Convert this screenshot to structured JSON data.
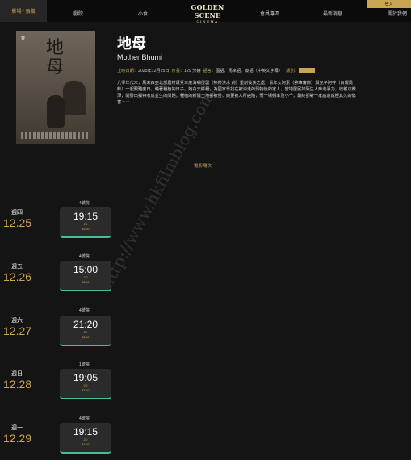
{
  "nav": {
    "left": "影場 / 預購",
    "items": [
      "戲院",
      "小食",
      "會員專區",
      "最新消息",
      "關於我們"
    ],
    "logo_line1": "GOLDEN SCENE",
    "logo_line2": "CINEMA",
    "login": "登入"
  },
  "movie": {
    "title_zh": "地母",
    "title_en": "Mother Bhumi",
    "poster_badge": "豐",
    "poster_title": "地母",
    "meta": {
      "release_label": "上映日期：",
      "release": "2025年12月25日",
      "runtime_label": "片長：",
      "runtime": "129 分鐘",
      "language_label": "語言：",
      "language": "國語、馬來語、泰語（中英文字幕）",
      "rating_label": "級別："
    },
    "synopsis": "九零年代末，馬來西亞北部農村遭受三度海嘯侵襲（熱帶洪水 劇）重創後失之處，青年女阿素（許瑋甯飾）與兒子阿梓（白耀喬 飾）一起艱難度日，藉著種植的日子。她白天耕種，為國家尋找在被沖走的穀物後的家人，當地居民如陌生人奔走爭力，收穫以微薄，開發出獨特收成並生的問題，種植的新疆土地卻被侵，她更被人所誣陷，而一場頻率及小千，最終卻對一家庭造成極其久的傷害⋯⋯"
  },
  "schedule_label": "電影場次",
  "schedule": [
    {
      "weekday": "週四",
      "date": "12.25",
      "hall": "4號院",
      "time": "19:15",
      "format": "2D",
      "price": "$100"
    },
    {
      "weekday": "週五",
      "date": "12.26",
      "hall": "4號院",
      "time": "15:00",
      "format": "2D",
      "price": "$100"
    },
    {
      "weekday": "週六",
      "date": "12.27",
      "hall": "4號院",
      "time": "21:20",
      "format": "2D",
      "price": "$100"
    },
    {
      "weekday": "週日",
      "date": "12.28",
      "hall": "1號院",
      "time": "19:05",
      "format": "2D",
      "price": "$100"
    },
    {
      "weekday": "週一",
      "date": "12.29",
      "hall": "4號院",
      "time": "19:15",
      "format": "2D",
      "price": "$100"
    }
  ],
  "watermark": "http://www.hkfilmblog.com/",
  "colors": {
    "accent": "#c9a552",
    "background": "#141414",
    "card_underline": "#3fbf9a"
  }
}
